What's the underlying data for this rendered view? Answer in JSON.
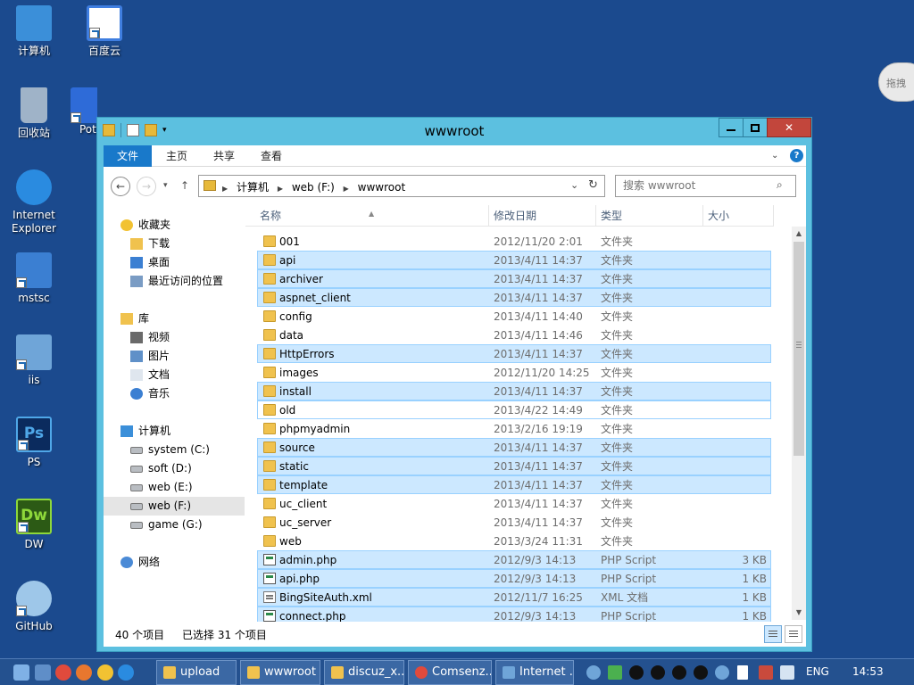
{
  "desktop": {
    "icons": [
      {
        "label": "计算机",
        "icon": "computer-icon",
        "color": "#3b8fd9"
      },
      {
        "label": "百度云",
        "icon": "baidu-cloud-icon",
        "color": "#3f7ee0"
      },
      {
        "label": "回收站",
        "icon": "recycle-bin-icon",
        "color": "#9fb3c8"
      },
      {
        "label": "Pot",
        "icon": "potplayer-icon",
        "color": "#2e6bd8"
      },
      {
        "label": "Internet Explorer",
        "icon": "internet-explorer-icon",
        "color": "#2a8be0"
      },
      {
        "label": "mstsc",
        "icon": "remote-desktop-icon",
        "color": "#3b7fd2"
      },
      {
        "label": "iis",
        "icon": "iis-icon",
        "color": "#6fa5d8"
      },
      {
        "label": "PS",
        "icon": "photoshop-icon",
        "color": "#0b2b5e"
      },
      {
        "label": "DW",
        "icon": "dreamweaver-icon",
        "color": "#2c5a15"
      },
      {
        "label": "GitHub",
        "icon": "github-icon",
        "color": "#9ec7e9"
      }
    ],
    "cloud_label": "拖拽"
  },
  "window": {
    "title": "wwwroot",
    "ribbon_tabs": [
      "文件",
      "主页",
      "共享",
      "查看"
    ],
    "address": {
      "crumbs": [
        "计算机",
        "web (F:)",
        "wwwroot"
      ]
    },
    "search_placeholder": "搜索 wwwroot"
  },
  "nav_pane": [
    {
      "label": "收藏夹",
      "icon": "star-icon",
      "level": 0
    },
    {
      "label": "下载",
      "icon": "downloads-folder-icon",
      "level": 1
    },
    {
      "label": "桌面",
      "icon": "desktop-icon",
      "level": 1
    },
    {
      "label": "最近访问的位置",
      "icon": "recent-places-icon",
      "level": 1
    },
    {
      "label": "库",
      "icon": "libraries-icon",
      "level": 0
    },
    {
      "label": "视频",
      "icon": "videos-icon",
      "level": 1
    },
    {
      "label": "图片",
      "icon": "pictures-icon",
      "level": 1
    },
    {
      "label": "文档",
      "icon": "documents-icon",
      "level": 1
    },
    {
      "label": "音乐",
      "icon": "music-icon",
      "level": 1
    },
    {
      "label": "计算机",
      "icon": "computer-icon",
      "level": 0
    },
    {
      "label": "system (C:)",
      "icon": "drive-icon",
      "level": 1
    },
    {
      "label": "soft (D:)",
      "icon": "drive-icon",
      "level": 1
    },
    {
      "label": "web (E:)",
      "icon": "drive-icon",
      "level": 1
    },
    {
      "label": "web (F:)",
      "icon": "drive-icon",
      "level": 1,
      "selected": true
    },
    {
      "label": "game (G:)",
      "icon": "drive-icon",
      "level": 1
    },
    {
      "label": "网络",
      "icon": "network-icon",
      "level": 0
    }
  ],
  "columns": {
    "name": "名称",
    "date": "修改日期",
    "type": "类型",
    "size": "大小"
  },
  "files": [
    {
      "name": "001",
      "date": "2012/11/20 2:01",
      "type": "文件夹",
      "size": "",
      "kind": "folder",
      "selected": false
    },
    {
      "name": "api",
      "date": "2013/4/11 14:37",
      "type": "文件夹",
      "size": "",
      "kind": "folder",
      "selected": true
    },
    {
      "name": "archiver",
      "date": "2013/4/11 14:37",
      "type": "文件夹",
      "size": "",
      "kind": "folder",
      "selected": true
    },
    {
      "name": "aspnet_client",
      "date": "2013/4/11 14:37",
      "type": "文件夹",
      "size": "",
      "kind": "folder",
      "selected": true
    },
    {
      "name": "config",
      "date": "2013/4/11 14:40",
      "type": "文件夹",
      "size": "",
      "kind": "folder",
      "selected": false
    },
    {
      "name": "data",
      "date": "2013/4/11 14:46",
      "type": "文件夹",
      "size": "",
      "kind": "folder",
      "selected": false
    },
    {
      "name": "HttpErrors",
      "date": "2013/4/11 14:37",
      "type": "文件夹",
      "size": "",
      "kind": "folder",
      "selected": true
    },
    {
      "name": "images",
      "date": "2012/11/20 14:25",
      "type": "文件夹",
      "size": "",
      "kind": "folder",
      "selected": false
    },
    {
      "name": "install",
      "date": "2013/4/11 14:37",
      "type": "文件夹",
      "size": "",
      "kind": "folder",
      "selected": true
    },
    {
      "name": "old",
      "date": "2013/4/22 14:49",
      "type": "文件夹",
      "size": "",
      "kind": "folder",
      "selected": false,
      "outlined": true
    },
    {
      "name": "phpmyadmin",
      "date": "2013/2/16 19:19",
      "type": "文件夹",
      "size": "",
      "kind": "folder",
      "selected": false
    },
    {
      "name": "source",
      "date": "2013/4/11 14:37",
      "type": "文件夹",
      "size": "",
      "kind": "folder",
      "selected": true
    },
    {
      "name": "static",
      "date": "2013/4/11 14:37",
      "type": "文件夹",
      "size": "",
      "kind": "folder",
      "selected": true
    },
    {
      "name": "template",
      "date": "2013/4/11 14:37",
      "type": "文件夹",
      "size": "",
      "kind": "folder",
      "selected": true
    },
    {
      "name": "uc_client",
      "date": "2013/4/11 14:37",
      "type": "文件夹",
      "size": "",
      "kind": "folder",
      "selected": false
    },
    {
      "name": "uc_server",
      "date": "2013/4/11 14:37",
      "type": "文件夹",
      "size": "",
      "kind": "folder",
      "selected": false
    },
    {
      "name": "web",
      "date": "2013/3/24 11:31",
      "type": "文件夹",
      "size": "",
      "kind": "folder",
      "selected": false
    },
    {
      "name": "admin.php",
      "date": "2012/9/3 14:13",
      "type": "PHP Script",
      "size": "3 KB",
      "kind": "php",
      "selected": true
    },
    {
      "name": "api.php",
      "date": "2012/9/3 14:13",
      "type": "PHP Script",
      "size": "1 KB",
      "kind": "php",
      "selected": true
    },
    {
      "name": "BingSiteAuth.xml",
      "date": "2012/11/7 16:25",
      "type": "XML 文档",
      "size": "1 KB",
      "kind": "xml",
      "selected": true
    },
    {
      "name": "connect.php",
      "date": "2012/9/3 14:13",
      "type": "PHP Script",
      "size": "1 KB",
      "kind": "php",
      "selected": true
    }
  ],
  "status": {
    "count": "40 个项目",
    "selection": "已选择 31 个项目"
  },
  "taskbar": {
    "tasks": [
      {
        "label": "upload",
        "icon": "folder-icon",
        "color": "#f0c24e"
      },
      {
        "label": "wwwroot",
        "icon": "folder-icon",
        "color": "#f0c24e"
      },
      {
        "label": "discuz_x...",
        "icon": "folder-icon",
        "color": "#f0c24e"
      },
      {
        "label": "Comsenz...",
        "icon": "chrome-icon",
        "color": "#e04a3c"
      },
      {
        "label": "Internet ...",
        "icon": "iis-manager-icon",
        "color": "#6fa5d8"
      }
    ],
    "lang": "ENG",
    "time": "14:53"
  },
  "colors": {
    "desktop": "#1b4a8e",
    "window_frame": "#5cc0e0",
    "selection": "#cce8ff",
    "accent": "#1979ca"
  }
}
